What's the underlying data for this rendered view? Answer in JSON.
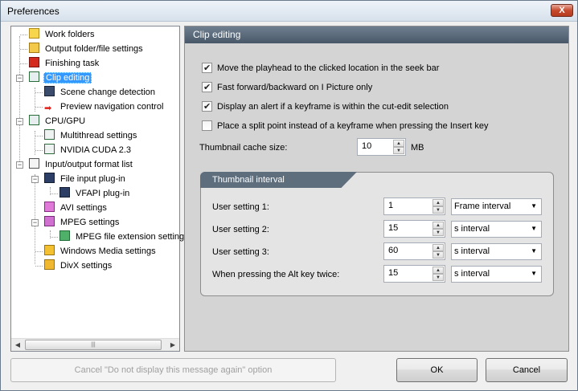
{
  "window": {
    "title": "Preferences",
    "close_glyph": "X"
  },
  "tree": {
    "items": [
      {
        "label": "Work folders",
        "icon": "folder-icon"
      },
      {
        "label": "Output folder/file settings",
        "icon": "output-folder-icon"
      },
      {
        "label": "Finishing task",
        "icon": "power-icon"
      },
      {
        "label": "Clip editing",
        "icon": "clip-edit-icon",
        "selected": true
      },
      {
        "label": "Scene change detection",
        "icon": "film-icon"
      },
      {
        "label": "Preview navigation control",
        "icon": "red-arrow-icon"
      },
      {
        "label": "CPU/GPU",
        "icon": "cpu-icon"
      },
      {
        "label": "Multithread settings",
        "icon": "settings-doc-icon"
      },
      {
        "label": "NVIDIA CUDA 2.3",
        "icon": "settings-doc-icon"
      },
      {
        "label": "Input/output format list",
        "icon": "list-icon"
      },
      {
        "label": "File input plug-in",
        "icon": "plugin-icon"
      },
      {
        "label": "VFAPI plug-in",
        "icon": "plugin-icon"
      },
      {
        "label": "AVI settings",
        "icon": "avi-icon"
      },
      {
        "label": "MPEG settings",
        "icon": "mpeg-icon"
      },
      {
        "label": "MPEG file extension setting",
        "icon": "mpeg-ext-icon"
      },
      {
        "label": "Windows Media settings",
        "icon": "wm-icon"
      },
      {
        "label": "DivX settings",
        "icon": "divx-icon"
      }
    ],
    "scrollbar": {
      "left_arrow": "◀",
      "right_arrow": "▶",
      "grip": "|||"
    }
  },
  "panel": {
    "title": "Clip editing",
    "checks": [
      {
        "label": "Move the playhead to the clicked location in the seek bar",
        "checked": true
      },
      {
        "label": "Fast forward/backward on I Picture only",
        "checked": true
      },
      {
        "label": "Display an alert if a keyframe is within the cut-edit selection",
        "checked": true
      },
      {
        "label": "Place a split point instead of a keyframe when pressing the Insert key",
        "checked": false
      }
    ],
    "cache": {
      "label": "Thumbnail cache size:",
      "value": "10",
      "unit": "MB"
    },
    "group": {
      "title": "Thumbnail interval",
      "rows": [
        {
          "label": "User setting 1:",
          "value": "1",
          "mode": "Frame interval"
        },
        {
          "label": "User setting 2:",
          "value": "15",
          "mode": "s interval"
        },
        {
          "label": "User setting 3:",
          "value": "60",
          "mode": "s interval"
        },
        {
          "label": "When pressing the Alt key twice:",
          "value": "15",
          "mode": "s interval"
        }
      ]
    }
  },
  "footer": {
    "cancel_msg_label": "Cancel \"Do not display this message again\" option",
    "ok_label": "OK",
    "cancel_label": "Cancel"
  },
  "glyphs": {
    "up": "▲",
    "down": "▼",
    "dropdown": "▼"
  }
}
